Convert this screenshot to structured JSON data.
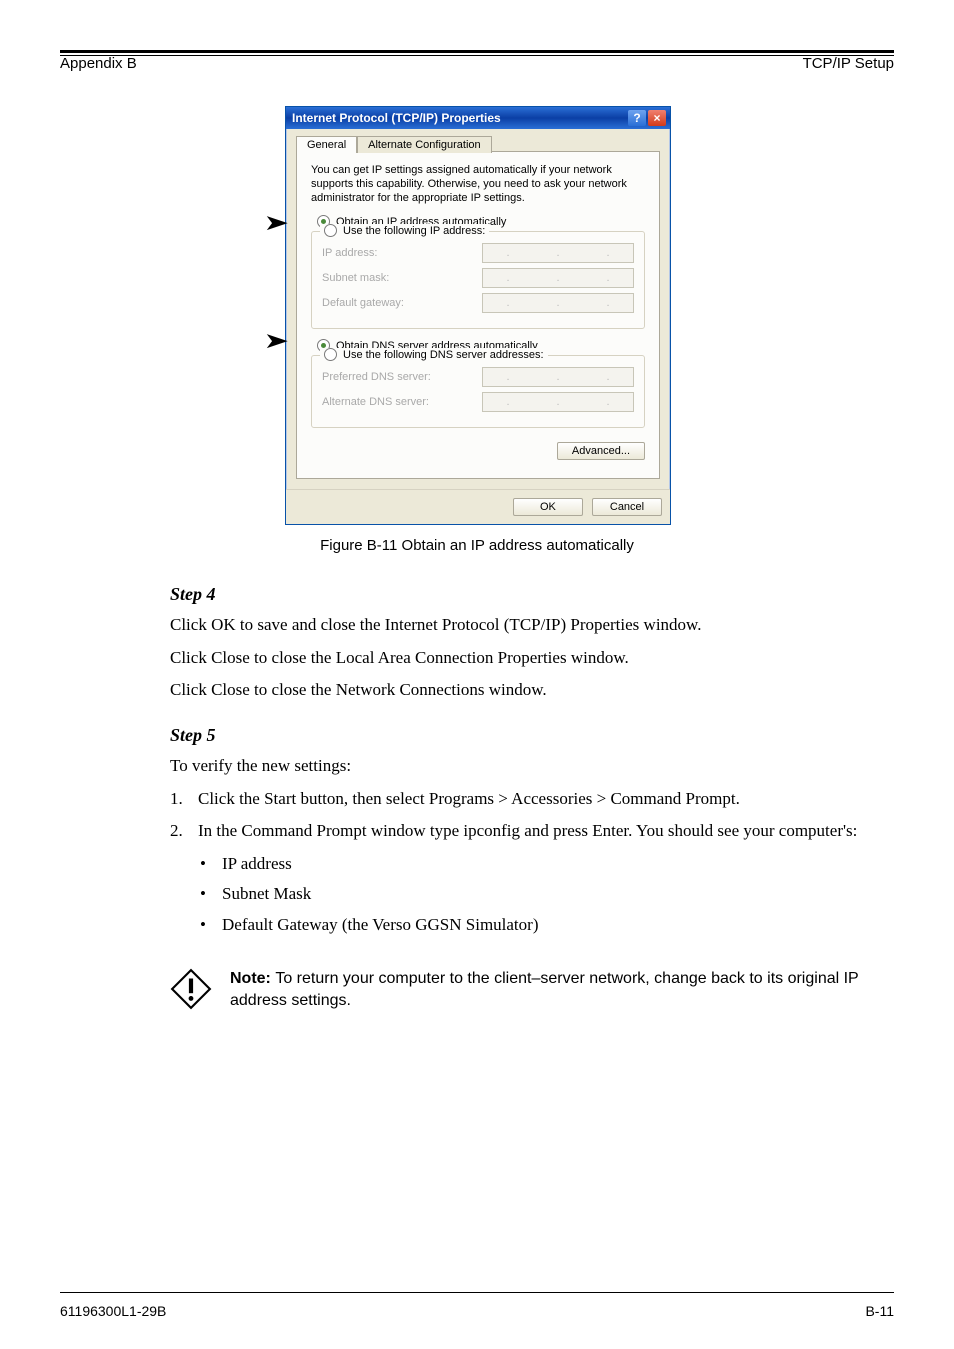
{
  "header": {
    "left": "Appendix B",
    "right": "TCP/IP Setup"
  },
  "dialog": {
    "title": "Internet Protocol (TCP/IP) Properties",
    "tabs": {
      "general": "General",
      "alt": "Alternate Configuration"
    },
    "description": "You can get IP settings assigned automatically if your network supports this capability. Otherwise, you need to ask your network administrator for the appropriate IP settings.",
    "radio_auto_ip": "Obtain an IP address automatically",
    "radio_use_ip": "Use the following IP address:",
    "ip_address": "IP address:",
    "subnet": "Subnet mask:",
    "gateway": "Default gateway:",
    "radio_auto_dns": "Obtain DNS server address automatically",
    "radio_use_dns": "Use the following DNS server addresses:",
    "pref_dns": "Preferred DNS server:",
    "alt_dns": "Alternate DNS server:",
    "advanced": "Advanced...",
    "ok": "OK",
    "cancel": "Cancel"
  },
  "caption": "Figure B-11 Obtain an IP address automatically",
  "steps": {
    "s4": {
      "heading": "Step 4",
      "p1": "Click OK to save and close the Internet Protocol (TCP/IP) Properties window.",
      "p2": "Click Close to close the Local Area Connection Properties window.",
      "p3": "Click Close to close the Network Connections window."
    },
    "s5": {
      "heading": "Step 5",
      "intro": "To verify the new settings:",
      "n1": "1.",
      "n1t": "Click the Start button, then select Programs > Accessories > Command Prompt.",
      "n2": "2.",
      "n2t": "In the Command Prompt window type ipconfig and press Enter. You should see your computer's:",
      "b1": "IP address",
      "b2": "Subnet Mask",
      "b3": "Default Gateway (the Verso GGSN Simulator)"
    }
  },
  "note": {
    "label": "Note: ",
    "text": "To return your computer to the client–server network, change back to its original IP address settings."
  },
  "footer": {
    "left": "61196300L1-29B",
    "right": "B-11"
  }
}
